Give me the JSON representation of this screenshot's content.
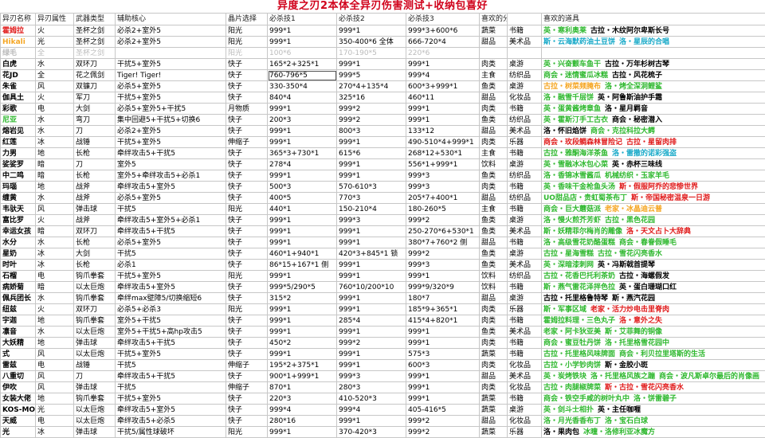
{
  "title": "异度之刃2本体全异刃伤害测试+收纳包喜好",
  "colors": {
    "title": "#d0021b",
    "green": "#2fb82f",
    "orange": "#f5a623",
    "red": "#e01b1b",
    "teal": "#17a9c8",
    "dim": "#bbbbbb",
    "black": "#000000",
    "brown": "#b8860b"
  },
  "headers": [
    "异刃名称",
    "异刃属性",
    "武器类型",
    "辅助核心",
    "晶片选择",
    "必杀技1",
    "必杀技2",
    "必杀技3",
    "喜欢的分类",
    "",
    "喜欢的道具"
  ],
  "rows": [
    {
      "name": "霍姆拉",
      "nameColor": "red",
      "cells": [
        "火",
        "圣杯之剑",
        "必杀2+室外5",
        "阳光",
        "999*1",
        "999*1",
        "999*3+600*6",
        "蔬菜",
        "书籍"
      ],
      "items": [
        [
          "英・寒利奥莱",
          "green"
        ],
        [
          "古拉・木纹阿尔卑斯长号",
          "black"
        ]
      ]
    },
    {
      "name": "Hikali",
      "nameColor": "orange",
      "cells": [
        "光",
        "圣杯之剑",
        "必杀2+室外5",
        "阳光",
        "999*1",
        "350-400*6 全体",
        "666-720*4",
        "甜品",
        "美术品"
      ],
      "items": [
        [
          "斯・云海默药油土豆饼",
          "teal"
        ],
        [
          "洛・星辰的合唱",
          "teal"
        ]
      ]
    },
    {
      "name": "绿毛",
      "nameColor": "black",
      "dim": true,
      "cells": [
        "全",
        "圣杯之剑",
        "",
        "阳光",
        "100*6",
        "170-190*5",
        "220*6",
        "",
        ""
      ],
      "items": []
    },
    {
      "name": "白虎",
      "nameColor": "black",
      "cells": [
        "水",
        "双环刀",
        "干扰5+室外5",
        "快子",
        "165*2+325*1",
        "999*1",
        "999*1",
        "肉类",
        "桌游"
      ],
      "items": [
        [
          "英・兴奋颤车鱼干",
          "green"
        ],
        [
          "古拉・万年杉树古琴",
          "black"
        ]
      ]
    },
    {
      "name": "花JD",
      "nameColor": "black",
      "cells": [
        "全",
        "花之佩剑",
        "Tiger! Tiger!",
        "快子",
        "760-796*5",
        "999*5",
        "999*4",
        "主食",
        "纺织品"
      ],
      "items": [
        [
          "商会・迷情蜜瓜冰糕",
          "green"
        ],
        [
          "古拉・风花梳子",
          "black"
        ]
      ],
      "sel": 5
    },
    {
      "name": "朱雀",
      "nameColor": "black",
      "cells": [
        "风",
        "双镰刀",
        "必杀5+室外5",
        "快子",
        "330-350*4",
        "270*4+135*4",
        "600*3+999*1",
        "鱼类",
        "桌游"
      ],
      "items": [
        [
          "古拉・树菜频腌布",
          "orange"
        ],
        [
          "洛・烤全深洞鲤鲨",
          "green"
        ]
      ]
    },
    {
      "name": "伽具土",
      "nameColor": "black",
      "cells": [
        "火",
        "军刀",
        "干扰5+室外5",
        "快子",
        "840*4",
        "325*16",
        "460*11",
        "甜品",
        "化妆品"
      ],
      "items": [
        [
          "洛・融雪千层饼",
          "green"
        ],
        [
          "英・阿鲁斯油护手霜",
          "black"
        ]
      ]
    },
    {
      "name": "彩歌",
      "nameColor": "black",
      "cells": [
        "电",
        "大剑",
        "必杀5+室外5+干扰5",
        "月物质",
        "999*1",
        "999*2",
        "999*1",
        "肉类",
        "书籍"
      ],
      "items": [
        [
          "英・蛋黄酱烤章鱼",
          "green"
        ],
        [
          "洛・星月羁音",
          "black"
        ]
      ]
    },
    {
      "name": "尼亚",
      "nameColor": "green",
      "cells": [
        "水",
        "弯刀",
        "集中回避5+干扰5+切换6",
        "快子",
        "200*3",
        "999*2",
        "999*1",
        "鱼类",
        "纺织品"
      ],
      "items": [
        [
          "英・霍斯汀手工古衣",
          "green"
        ],
        [
          "商会・秘密潜入",
          "black"
        ]
      ]
    },
    {
      "name": "熔岩见",
      "nameColor": "black",
      "cells": [
        "水",
        "刀",
        "必杀2+室外5",
        "快子",
        "999*1",
        "800*3",
        "133*12",
        "甜品",
        "美术品"
      ],
      "items": [
        [
          "洛・怀旧焰饼",
          "black"
        ],
        [
          "商会・克拉科拉大鳄",
          "green"
        ]
      ]
    },
    {
      "name": "红莲",
      "nameColor": "black",
      "cells": [
        "冰",
        "战锤",
        "干扰5+室外5",
        "伸缩子",
        "999*1",
        "999*1",
        "490-510*4+999*1",
        "肉类",
        "乐器"
      ],
      "items": [
        [
          "商会・玫段鲷森林冒险记",
          "red"
        ],
        [
          "古拉・星留肉排",
          "red"
        ]
      ]
    },
    {
      "name": "力男",
      "nameColor": "black",
      "cells": [
        "地",
        "长枪",
        "牵绊攻击5+干扰5",
        "快子",
        "365*3+730*1",
        "615*6",
        "268*12+530*1",
        "主食",
        "书籍"
      ],
      "items": [
        [
          "古拉・雅酮海洋茶鱼",
          "green"
        ],
        [
          "洛・雷撒的诺彩强盗",
          "teal"
        ]
      ]
    },
    {
      "name": "娑娑罗",
      "nameColor": "black",
      "cells": [
        "暗",
        "刀",
        "室外5",
        "快子",
        "278*4",
        "999*1",
        "556*1+999*1",
        "饮料",
        "桌游"
      ],
      "items": [
        [
          "英・雪融冰冰包心菜",
          "green"
        ],
        [
          "英・赤杯三味线",
          "black"
        ]
      ]
    },
    {
      "name": "中二鸣",
      "nameColor": "black",
      "cells": [
        "暗",
        "长枪",
        "室外5+牵绊攻击5+必杀1",
        "快子",
        "999*1",
        "999*1",
        "999*3",
        "鱼类",
        "纺织品"
      ],
      "items": [
        [
          "洛・香锦冰雪酱瓜",
          "green"
        ],
        [
          "机械纺织・玉家羊毛",
          "green"
        ]
      ]
    },
    {
      "name": "玛瑙",
      "nameColor": "black",
      "cells": [
        "地",
        "战斧",
        "牵绊攻击5+室外5",
        "快子",
        "500*3",
        "570-610*3",
        "999*3",
        "肉类",
        "书籍"
      ],
      "items": [
        [
          "英・香味干金枪鱼头汤",
          "green"
        ],
        [
          "斯・假服阿乔的悲惨世界",
          "red"
        ]
      ]
    },
    {
      "name": "缠黄",
      "nameColor": "black",
      "cells": [
        "水",
        "战斧",
        "必杀5+室外5",
        "快子",
        "400*5",
        "770*3",
        "205*7+400*1",
        "甜品",
        "纺织品"
      ],
      "items": [
        [
          "UO甜品店・贵虹蜀茶布丁",
          "green"
        ],
        [
          "斯・帝国秘密温泉一日游",
          "red"
        ]
      ]
    },
    {
      "name": "韦驮天",
      "nameColor": "black",
      "cells": [
        "风",
        "弹击球",
        "干扰5",
        "阳光",
        "440*1",
        "150-210*4",
        "180-260*5",
        "主食",
        "书籍"
      ],
      "items": [
        [
          "商会・巨大蘑菇派",
          "green"
        ],
        [
          "老家・冰晶迪云普",
          "orange"
        ]
      ]
    },
    {
      "name": "富比罗",
      "nameColor": "black",
      "cells": [
        "火",
        "战斧",
        "牵绊攻击5+室外5+必杀1",
        "快子",
        "999*1",
        "999*3",
        "999*2",
        "鱼类",
        "桌游"
      ],
      "items": [
        [
          "洛・慢火煎芥芳虾",
          "green"
        ],
        [
          "古拉・黑色花园",
          "green"
        ]
      ]
    },
    {
      "name": "幸运女孩",
      "nameColor": "black",
      "cells": [
        "暗",
        "双环刀",
        "牵绊攻击5+干扰5",
        "快子",
        "999*1",
        "999*1",
        "250-270*6+530*1",
        "鱼类",
        "美术品"
      ],
      "items": [
        [
          "斯・妖精菲尔梅肖的雕像",
          "green"
        ],
        [
          "洛・天文占卜大辞典",
          "red"
        ]
      ]
    },
    {
      "name": "水分",
      "nameColor": "black",
      "cells": [
        "水",
        "长枪",
        "必杀5+室外5",
        "快子",
        "999*1",
        "999*1",
        "380*7+760*2 侧",
        "甜品",
        "书籍"
      ],
      "items": [
        [
          "洛・高级雪花奶酪蛋糕",
          "green"
        ],
        [
          "商会・春眷假睡毛",
          "green"
        ]
      ]
    },
    {
      "name": "星奶",
      "nameColor": "black",
      "cells": [
        "冰",
        "大剑",
        "干扰5",
        "快子",
        "460*1+940*1",
        "420*3+845*1 锁",
        "999*2",
        "鱼类",
        "桌游"
      ],
      "items": [
        [
          "古拉・星海雪糕",
          "green"
        ],
        [
          "古拉・雪花闪亮香水",
          "green"
        ]
      ]
    },
    {
      "name": "时叶",
      "nameColor": "black",
      "cells": [
        "冰",
        "长枪",
        "必杀1",
        "快子",
        "86*15+167*1 侧",
        "999*1",
        "999*3",
        "鱼类",
        "美术品"
      ],
      "items": [
        [
          "英・深暗漆刺网",
          "green"
        ],
        [
          "英・冯斯戟首提琴",
          "black"
        ]
      ]
    },
    {
      "name": "石榴",
      "nameColor": "black",
      "cells": [
        "电",
        "钩爪拳套",
        "干扰5+室外5",
        "阳光",
        "999*1",
        "999*1",
        "999*1",
        "饮料",
        "纺织品"
      ],
      "items": [
        [
          "古拉・花香巴托利茶奶",
          "green"
        ],
        [
          "古拉・海螺假发",
          "black"
        ]
      ]
    },
    {
      "name": "病娇菊",
      "nameColor": "black",
      "cells": [
        "暗",
        "以太巨炮",
        "牵绊攻击5+室外5",
        "快子",
        "999*5/290*5",
        "760*10/200*10",
        "999*9/320*9",
        "饮料",
        "书籍"
      ],
      "items": [
        [
          "斯・燕气雷花泽拌色拉",
          "green"
        ],
        [
          "英・蛋白珊瑚口红",
          "black"
        ]
      ]
    },
    {
      "name": "佩兵团长",
      "nameColor": "black",
      "cells": [
        "水",
        "钩爪拳套",
        "牵绊max壁障5/切换缩短6",
        "快子",
        "315*2",
        "999*1",
        "180*7",
        "甜品",
        "桌游"
      ],
      "items": [
        [
          "古拉・托里格鲁特琴",
          "black"
        ],
        [
          "斯・燕汽花园",
          "black"
        ]
      ]
    },
    {
      "name": "纽兹",
      "nameColor": "black",
      "cells": [
        "火",
        "双环刀",
        "必杀5+必杀3",
        "阳光",
        "999*1",
        "999*1",
        "185*9+365*1",
        "肉类",
        "乐器"
      ],
      "items": [
        [
          "斯・军事区域",
          "green"
        ],
        [
          "老家・活力炒电击里脊肉",
          "red"
        ]
      ]
    },
    {
      "name": "宇迦",
      "nameColor": "black",
      "cells": [
        "地",
        "钩爪拳套",
        "室外5+干扰5",
        "快子",
        "999*1",
        "285*4",
        "415*4+820*1",
        "肉类",
        "书籍"
      ],
      "items": [
        [
          "霍姆拉料理・三色丸子",
          "green"
        ],
        [
          "洛・意外之失",
          "red"
        ]
      ]
    },
    {
      "name": "凛音",
      "nameColor": "black",
      "cells": [
        "水",
        "以太巨炮",
        "室外5+干扰5+高hp攻击5",
        "快子",
        "999*1",
        "999*1",
        "999*1",
        "鱼类",
        "美术品"
      ],
      "items": [
        [
          "老家・阿卡狄亚美",
          "green"
        ],
        [
          "斯・艾菲舞的铜像",
          "green"
        ]
      ]
    },
    {
      "name": "大妖精",
      "nameColor": "black",
      "cells": [
        "地",
        "弹击球",
        "牵绊攻击5+干扰5",
        "快子",
        "450*2",
        "999*2",
        "999*1",
        "肉类",
        "书籍"
      ],
      "items": [
        [
          "商会・蜜豆牡丹饼",
          "green"
        ],
        [
          "洛・托里格雪花园中",
          "green"
        ]
      ]
    },
    {
      "name": "式",
      "nameColor": "black",
      "cells": [
        "风",
        "以太巨炮",
        "干扰5+室外5",
        "快子",
        "999*1",
        "999*1",
        "575*3",
        "蔬菜",
        "书籍"
      ],
      "items": [
        [
          "古拉・托里格风味牌面",
          "green"
        ],
        [
          "商会・利贝拉里塔斯的生活",
          "green"
        ]
      ]
    },
    {
      "name": "雷兹",
      "nameColor": "black",
      "cells": [
        "电",
        "战锤",
        "干扰5",
        "伸缩子",
        "195*2+375*1",
        "999*1",
        "600*3",
        "肉类",
        "化妆品"
      ],
      "items": [
        [
          "古拉・小学钞肉饼",
          "green"
        ],
        [
          "斯・金胶小斑",
          "black"
        ]
      ]
    },
    {
      "name": "八重切",
      "nameColor": "black",
      "cells": [
        "风",
        "刀",
        "牵绊攻击5+干扰5",
        "快子",
        "900*1+999*1",
        "999*3",
        "999*1",
        "甜品",
        "美术品"
      ],
      "items": [
        [
          "英・炭烤铁块",
          "green"
        ],
        [
          "洛・托里格风族之蹦",
          "green"
        ],
        [
          "商会・波凡斯卓尔最后的肖像画",
          "green"
        ]
      ]
    },
    {
      "name": "伊吹",
      "nameColor": "black",
      "cells": [
        "风",
        "弹击球",
        "干扰5",
        "伸缩子",
        "870*1",
        "280*3",
        "999*1",
        "肉类",
        "化妆品"
      ],
      "items": [
        [
          "古拉・肉腿椒牌菜",
          "green"
        ],
        [
          "斯・古拉・雪花闪亮香水",
          "red"
        ]
      ]
    },
    {
      "name": "女装大佬",
      "nameColor": "black",
      "cells": [
        "地",
        "钩爪拳套",
        "干扰5+室外5",
        "快子",
        "220*3",
        "410-520*3",
        "999*1",
        "蔬菜",
        "书籍"
      ],
      "items": [
        [
          "商会・铁空手咸的树叶丸中",
          "green"
        ],
        [
          "洛・饼雷碧子",
          "green"
        ]
      ]
    },
    {
      "name": "KOS-MOS",
      "nameColor": "black",
      "cells": [
        "光",
        "以太巨炮",
        "牵绊攻击5+室外5",
        "快子",
        "999*4",
        "999*4",
        "405-416*5",
        "蔬菜",
        "桌游"
      ],
      "items": [
        [
          "英・剑斗士相扑",
          "green"
        ],
        [
          "英・主任咖喱",
          "black"
        ]
      ]
    },
    {
      "name": "天威",
      "nameColor": "black",
      "cells": [
        "电",
        "以太巨炮",
        "牵绊攻击5+必杀5",
        "快子",
        "280*16",
        "999*1",
        "999*2",
        "甜品",
        "化妆品"
      ],
      "items": [
        [
          "洛・月光香香布丁",
          "green"
        ],
        [
          "洛・宝石白球",
          "green"
        ]
      ]
    },
    {
      "name": "光",
      "nameColor": "black",
      "cells": [
        "冰",
        "弹击球",
        "干扰5/属性球破坏",
        "阳光",
        "999*1",
        "370-420*3",
        "999*2",
        "蔬菜",
        "乐器"
      ],
      "items": [
        [
          "洛・果肉包",
          "black"
        ],
        [
          "冰曈・洛修利亚冰魔方",
          "green"
        ]
      ]
    }
  ]
}
